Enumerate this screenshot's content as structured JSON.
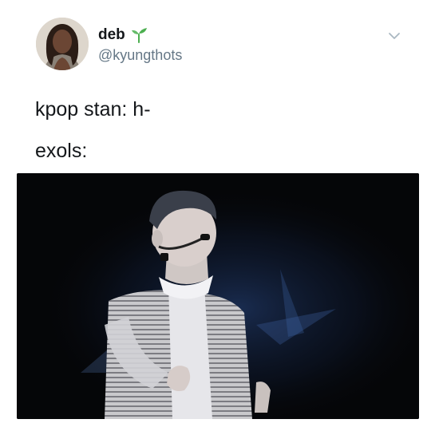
{
  "tweet": {
    "author": {
      "display_name": "deb",
      "handle": "@kyungthots",
      "avatar_icon": "avatar-photo",
      "badge_icon": "sprout-icon"
    },
    "menu_icon": "chevron-down-icon",
    "text_lines": [
      "kpop stan: h-",
      "exols:"
    ],
    "media": {
      "type": "image",
      "icon": "concert-performer-photo"
    }
  },
  "colors": {
    "text": "#14171a",
    "handle": "#657786",
    "sprout": "#4caf50",
    "chevron": "#aab8c2",
    "media_background": "#050608"
  }
}
